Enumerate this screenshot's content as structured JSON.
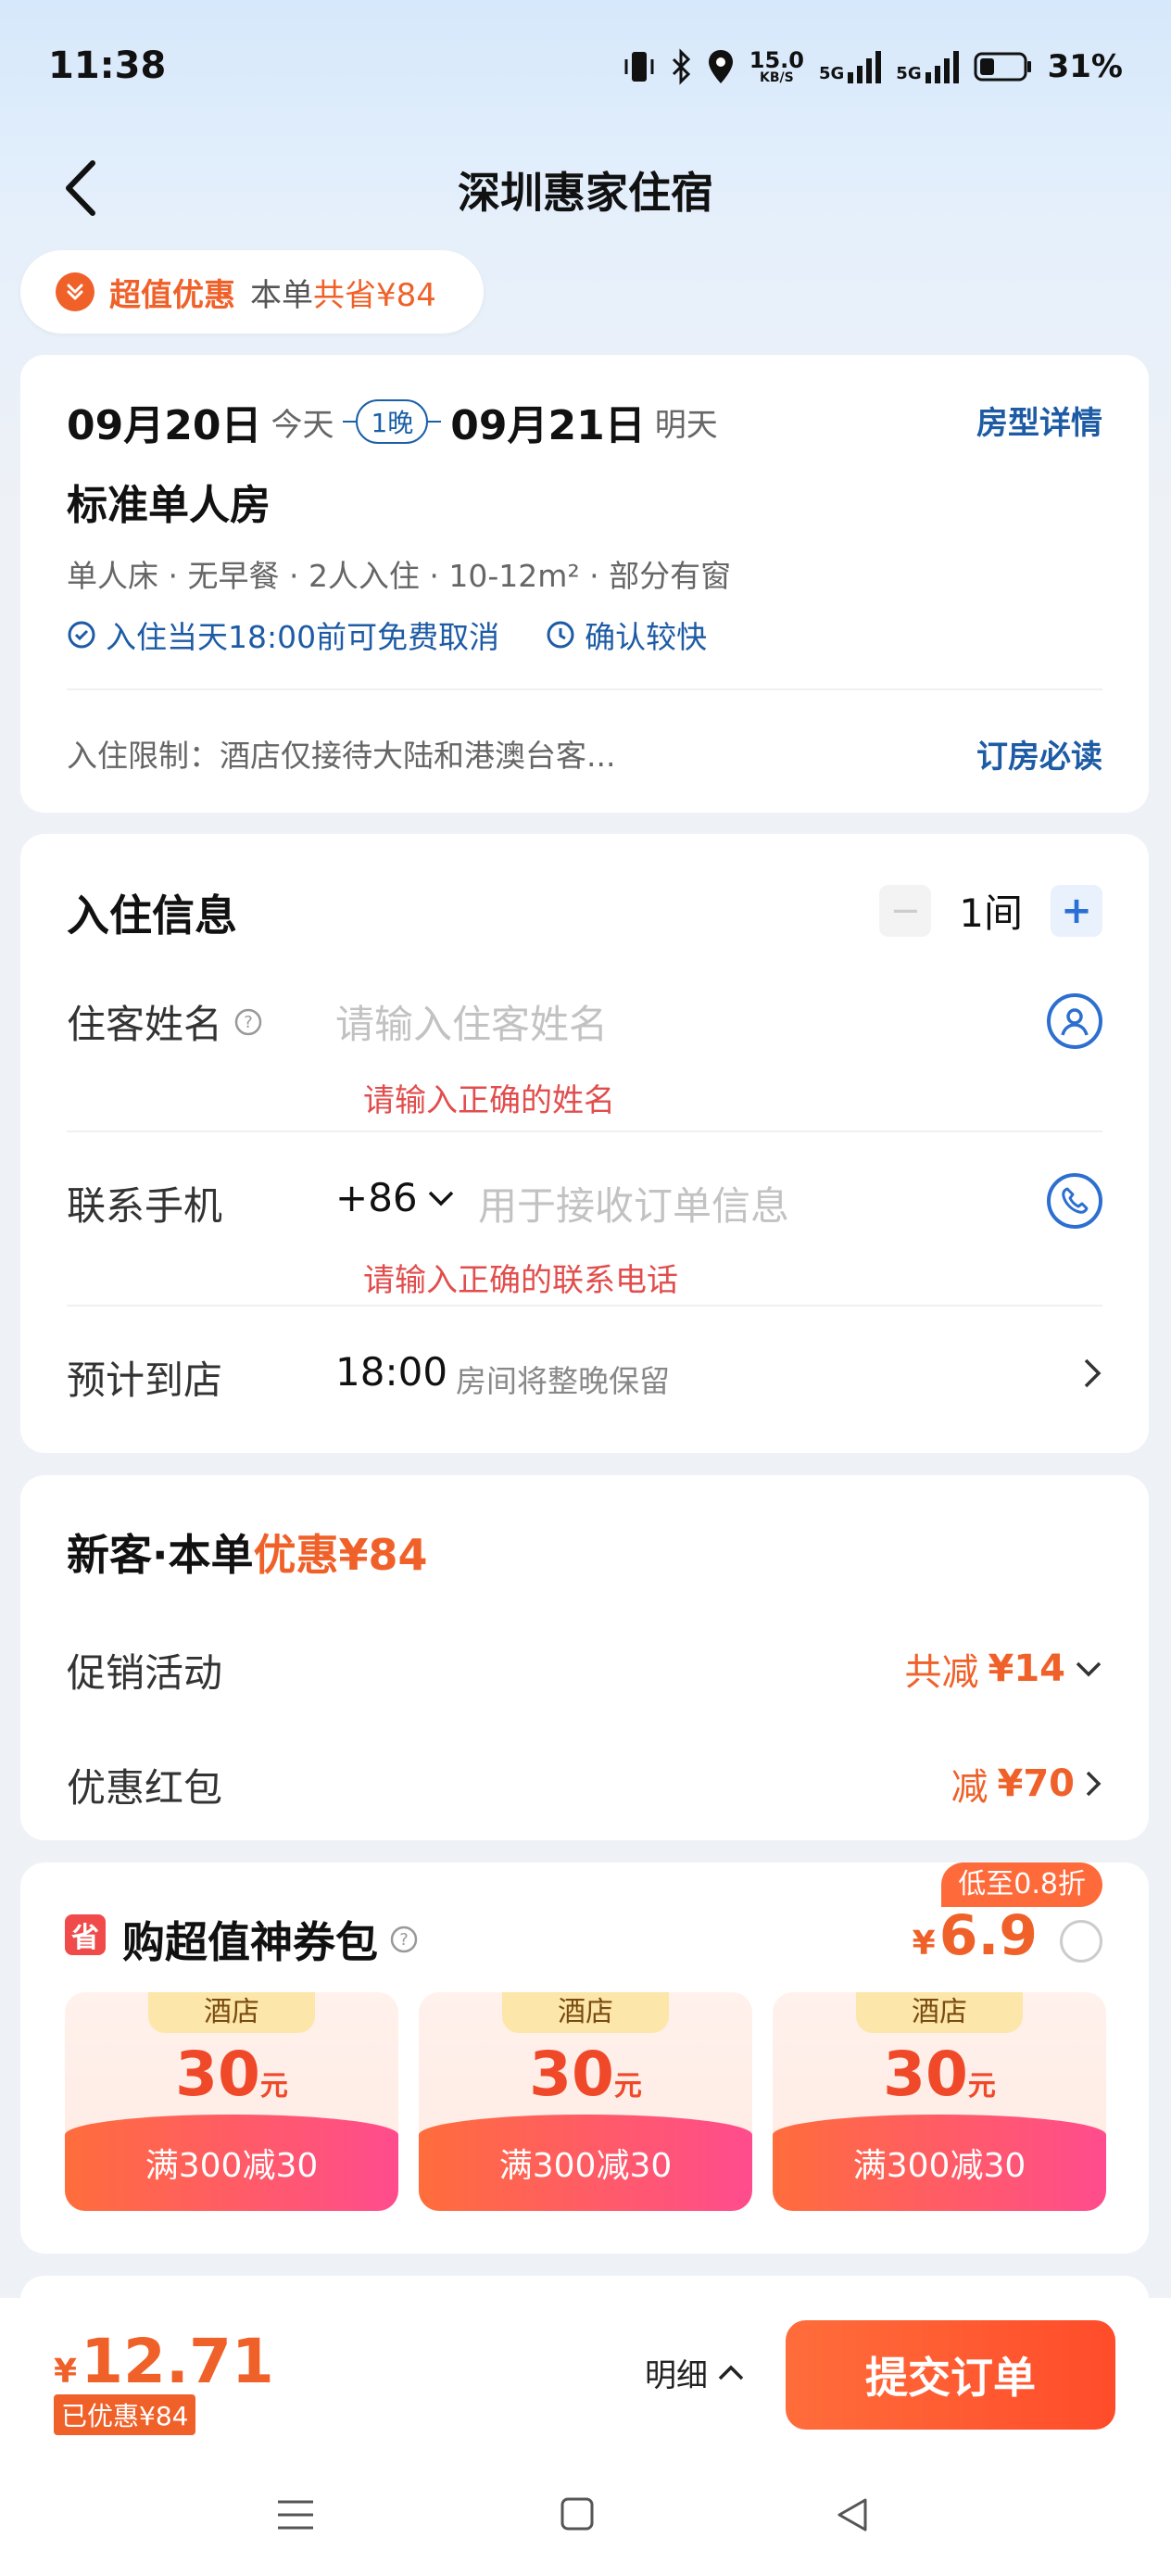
{
  "status": {
    "time": "11:38",
    "net_speed_value": "15.0",
    "net_speed_unit": "KB/S",
    "sig1_label": "5G",
    "sig2_label": "5G",
    "battery": "31%"
  },
  "header": {
    "title": "深圳惠家住宿"
  },
  "promo": {
    "label": "超值优惠",
    "text_prefix": "本单",
    "text_highlight": "共省¥84"
  },
  "booking": {
    "checkin_date": "09月20日",
    "checkin_day": "今天",
    "nights": "1晚",
    "checkout_date": "09月21日",
    "checkout_day": "明天",
    "room_detail_link": "房型详情",
    "room_name": "标准单人房",
    "room_attrs": "单人床 · 无早餐 · 2人入住 · 10-12m² · 部分有窗",
    "tag_cancel": "入住当天18:00前可免费取消",
    "tag_confirm": "确认较快",
    "restriction": "入住限制：酒店仅接待大陆和港澳台客...",
    "must_read": "订房必读"
  },
  "checkin": {
    "title": "入住信息",
    "room_count": "1间",
    "guest_label": "住客姓名",
    "guest_placeholder": "请输入住客姓名",
    "guest_error": "请输入正确的姓名",
    "phone_label": "联系手机",
    "phone_code": "+86",
    "phone_placeholder": "用于接收订单信息",
    "phone_error": "请输入正确的联系电话",
    "arrival_label": "预计到店",
    "arrival_time": "18:00",
    "arrival_note": "房间将整晚保留"
  },
  "discount": {
    "title_prefix": "新客·本单",
    "title_highlight": "优惠¥84",
    "promo_label": "促销活动",
    "promo_value_prefix": "共减",
    "promo_value": "¥14",
    "redpack_label": "优惠红包",
    "redpack_value_prefix": "减",
    "redpack_value": "¥70"
  },
  "coupon_pack": {
    "badge": "省",
    "title": "购超值神券包",
    "price_badge": "低至0.8折",
    "currency": "¥",
    "price": "6.9",
    "coupons": [
      {
        "tag": "酒店",
        "amount": "30",
        "unit": "元",
        "rule": "满300减30"
      },
      {
        "tag": "酒店",
        "amount": "30",
        "unit": "元",
        "rule": "满300减30"
      },
      {
        "tag": "酒店",
        "amount": "30",
        "unit": "元",
        "rule": "满300减30"
      }
    ]
  },
  "footer": {
    "currency": "¥",
    "total": "12.71",
    "saved": "已优惠¥84",
    "detail": "明细",
    "submit": "提交订单"
  },
  "colors": {
    "accent": "#f0612a",
    "link": "#1d5ba5",
    "error": "#e24d4d",
    "submit_start": "#ff6d3b",
    "submit_end": "#ff4c2a"
  }
}
